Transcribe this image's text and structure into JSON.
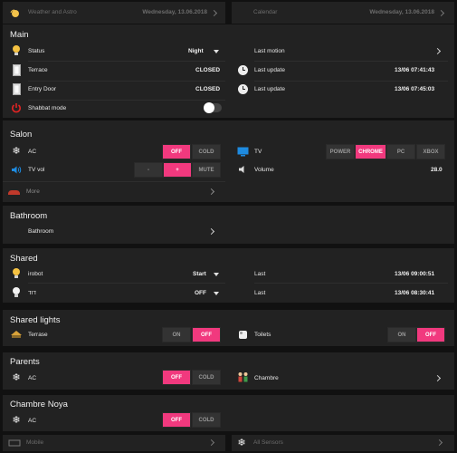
{
  "top_left": {
    "title": "Weather and Astro",
    "date": "Wednesday, 13.06.2018"
  },
  "top_right": {
    "title": "Calendar",
    "date": "Wednesday, 13.06.2018"
  },
  "main": {
    "title": "Main",
    "status": {
      "label": "Status",
      "value": "Night"
    },
    "terrace": {
      "label": "Terrace",
      "value": "CLOSED"
    },
    "entry_door": {
      "label": "Entry Door",
      "value": "CLOSED"
    },
    "shabbat": {
      "label": "Shabbat mode"
    },
    "last_motion": {
      "label": "Last motion"
    },
    "last_update_1": {
      "label": "Last update",
      "value": "13/06 07:41:43"
    },
    "last_update_2": {
      "label": "Last update",
      "value": "13/06 07:45:03"
    }
  },
  "salon": {
    "title": "Salon",
    "ac": {
      "label": "AC",
      "off": "OFF",
      "cold": "COLD"
    },
    "tv_vol": {
      "label": "TV vol",
      "minus": "-",
      "plus": "+",
      "mute": "MUTE"
    },
    "tv": {
      "label": "TV",
      "options": [
        "POWER",
        "CHROME",
        "PC",
        "XBOX"
      ]
    },
    "volume": {
      "label": "Volume",
      "value": "28.0"
    },
    "more": "More"
  },
  "bathroom": {
    "title": "Bathroom",
    "item": "Bathroom"
  },
  "shared": {
    "title": "Shared",
    "irobot": {
      "label": "irobot",
      "value": "Start"
    },
    "dud": {
      "label": "דוד",
      "value": "OFF"
    },
    "last_1": {
      "label": "Last",
      "value": "13/06 09:00:51"
    },
    "last_2": {
      "label": "Last",
      "value": "13/06 08:30:41"
    }
  },
  "shared_lights": {
    "title": "Shared lights",
    "terrase": {
      "label": "Terrase",
      "on": "ON",
      "off": "OFF"
    },
    "toilets": {
      "label": "Toilets",
      "on": "ON",
      "off": "OFF"
    }
  },
  "parents": {
    "title": "Parents",
    "ac": {
      "label": "AC",
      "off": "OFF",
      "cold": "COLD"
    },
    "chambre": {
      "label": "Chambre"
    }
  },
  "chambre_noya": {
    "title": "Chambre Noya",
    "ac": {
      "label": "AC",
      "off": "OFF",
      "cold": "COLD"
    }
  },
  "bottom": {
    "mobile": "Mobile",
    "all_sensors": "All Sensors"
  },
  "colors": {
    "accent": "#f1397e",
    "panel": "#222222",
    "background": "#111111"
  }
}
